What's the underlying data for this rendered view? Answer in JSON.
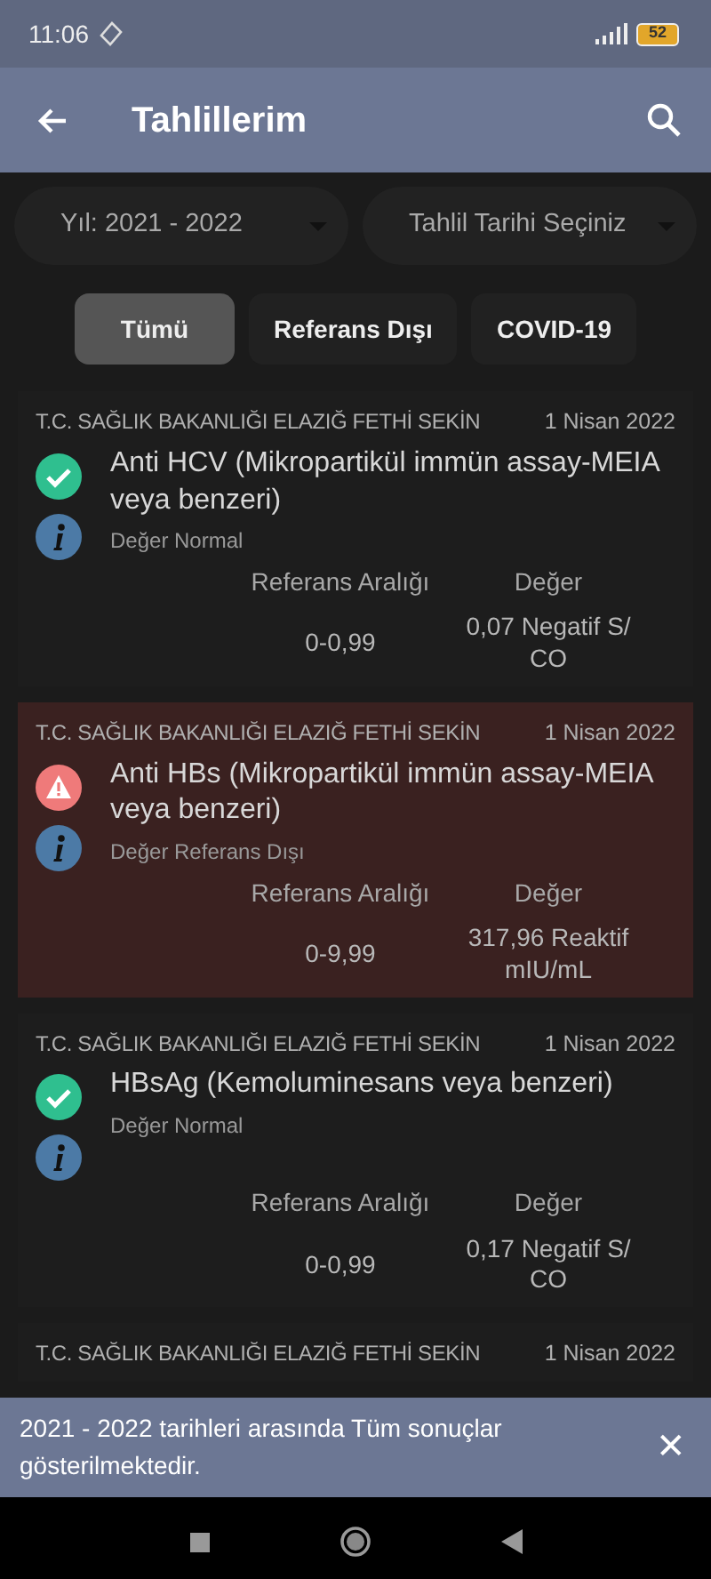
{
  "status_bar": {
    "time": "11:06",
    "battery": "52"
  },
  "app_bar": {
    "title": "Tahlillerim"
  },
  "filters": [
    {
      "label": "Yıl: 2021 - 2022"
    },
    {
      "label": "Tahlil Tarihi Seçiniz"
    }
  ],
  "chips": [
    {
      "label": "Tümü",
      "selected": true
    },
    {
      "label": "Referans Dışı",
      "selected": false
    },
    {
      "label": "COVID-19",
      "selected": false
    }
  ],
  "results": [
    {
      "hospital": "T.C. SAĞLIK BAKANLIĞI ELAZIĞ FETHİ SEKİN",
      "date": "1 Nisan 2022",
      "out_of_range": false,
      "test": "Anti HCV (Mikropartikül immün assay-MEIA veya benzeri)",
      "status": "Değer Normal",
      "ref_label": "Referans Aralığı",
      "value_label": "Değer",
      "ref": "0-0,99",
      "value": "0,07 Negatif S/ CO"
    },
    {
      "hospital": "T.C. SAĞLIK BAKANLIĞI ELAZIĞ FETHİ SEKİN",
      "date": "1 Nisan 2022",
      "out_of_range": true,
      "test": "Anti HBs  (Mikropartikül immün assay-MEIA veya benzeri)",
      "status": "Değer Referans Dışı",
      "ref_label": "Referans Aralığı",
      "value_label": "Değer",
      "ref": "0-9,99",
      "value": "317,96 Reaktif mIU/mL"
    },
    {
      "hospital": "T.C. SAĞLIK BAKANLIĞI ELAZIĞ FETHİ SEKİN",
      "date": "1 Nisan 2022",
      "out_of_range": false,
      "test": "HBsAg (Kemoluminesans veya benzeri)",
      "status": "Değer Normal",
      "ref_label": "Referans Aralığı",
      "value_label": "Değer",
      "ref": "0-0,99",
      "value": "0,17 Negatif S/ CO"
    },
    {
      "hospital": "T.C. SAĞLIK BAKANLIĞI ELAZIĞ FETHİ SEKİN",
      "date": "1 Nisan 2022"
    }
  ],
  "snackbar": {
    "message": "2021 - 2022 tarihleri arasında Tüm sonuçlar gösterilmektedir.",
    "close": "✕"
  }
}
